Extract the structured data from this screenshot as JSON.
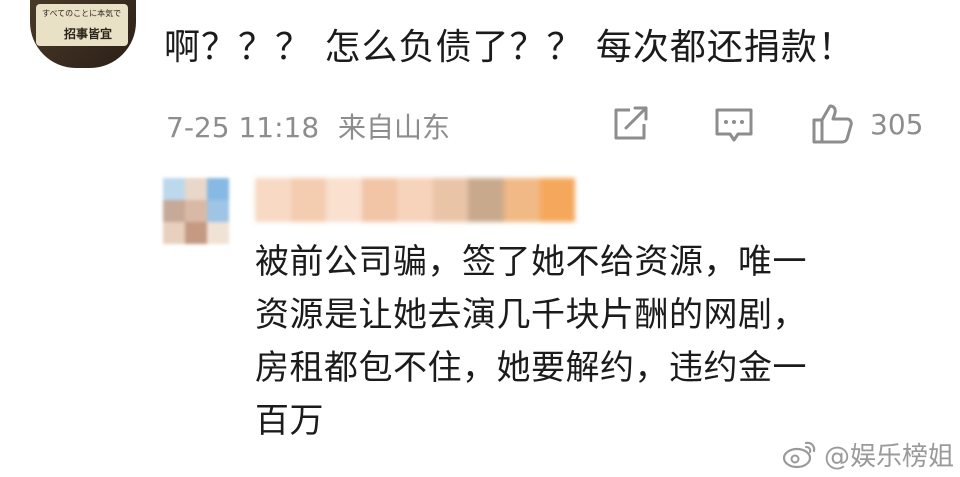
{
  "top_comment": {
    "avatar_sign_small": "すべてのことに本気で!",
    "avatar_sign_large": "招事皆宜",
    "text": "啊？？？ 怎么负债了？？ 每次都还捐款！",
    "date": "7-25 11:18",
    "location": "来自山东",
    "like_count": "305",
    "icons": [
      "repost-icon",
      "comment-icon",
      "like-icon"
    ]
  },
  "reply": {
    "avatar_colors": [
      "#bcd8ec",
      "#e9d7c9",
      "#86b9e3",
      "#c7a99a",
      "#d9b9a6",
      "#9ec4e6",
      "#e7d0bd",
      "#c49a82",
      "#f0e2d4"
    ],
    "name_colors": [
      "#f7d9c4",
      "#f4ccb0",
      "#f9e0cf",
      "#f1c5a6",
      "#f6d3bb",
      "#e9c4a7",
      "#c9a98c",
      "#f1b985",
      "#f5a85c"
    ],
    "lines": [
      "被前公司骗，签了她不给资源，唯一",
      "资源是让她去演几千块片酬的网剧，",
      "房租都包不住，她要解约，违约金一",
      "百万"
    ]
  },
  "watermark": {
    "text": "@娱乐榜姐",
    "icon": "weibo-icon"
  }
}
